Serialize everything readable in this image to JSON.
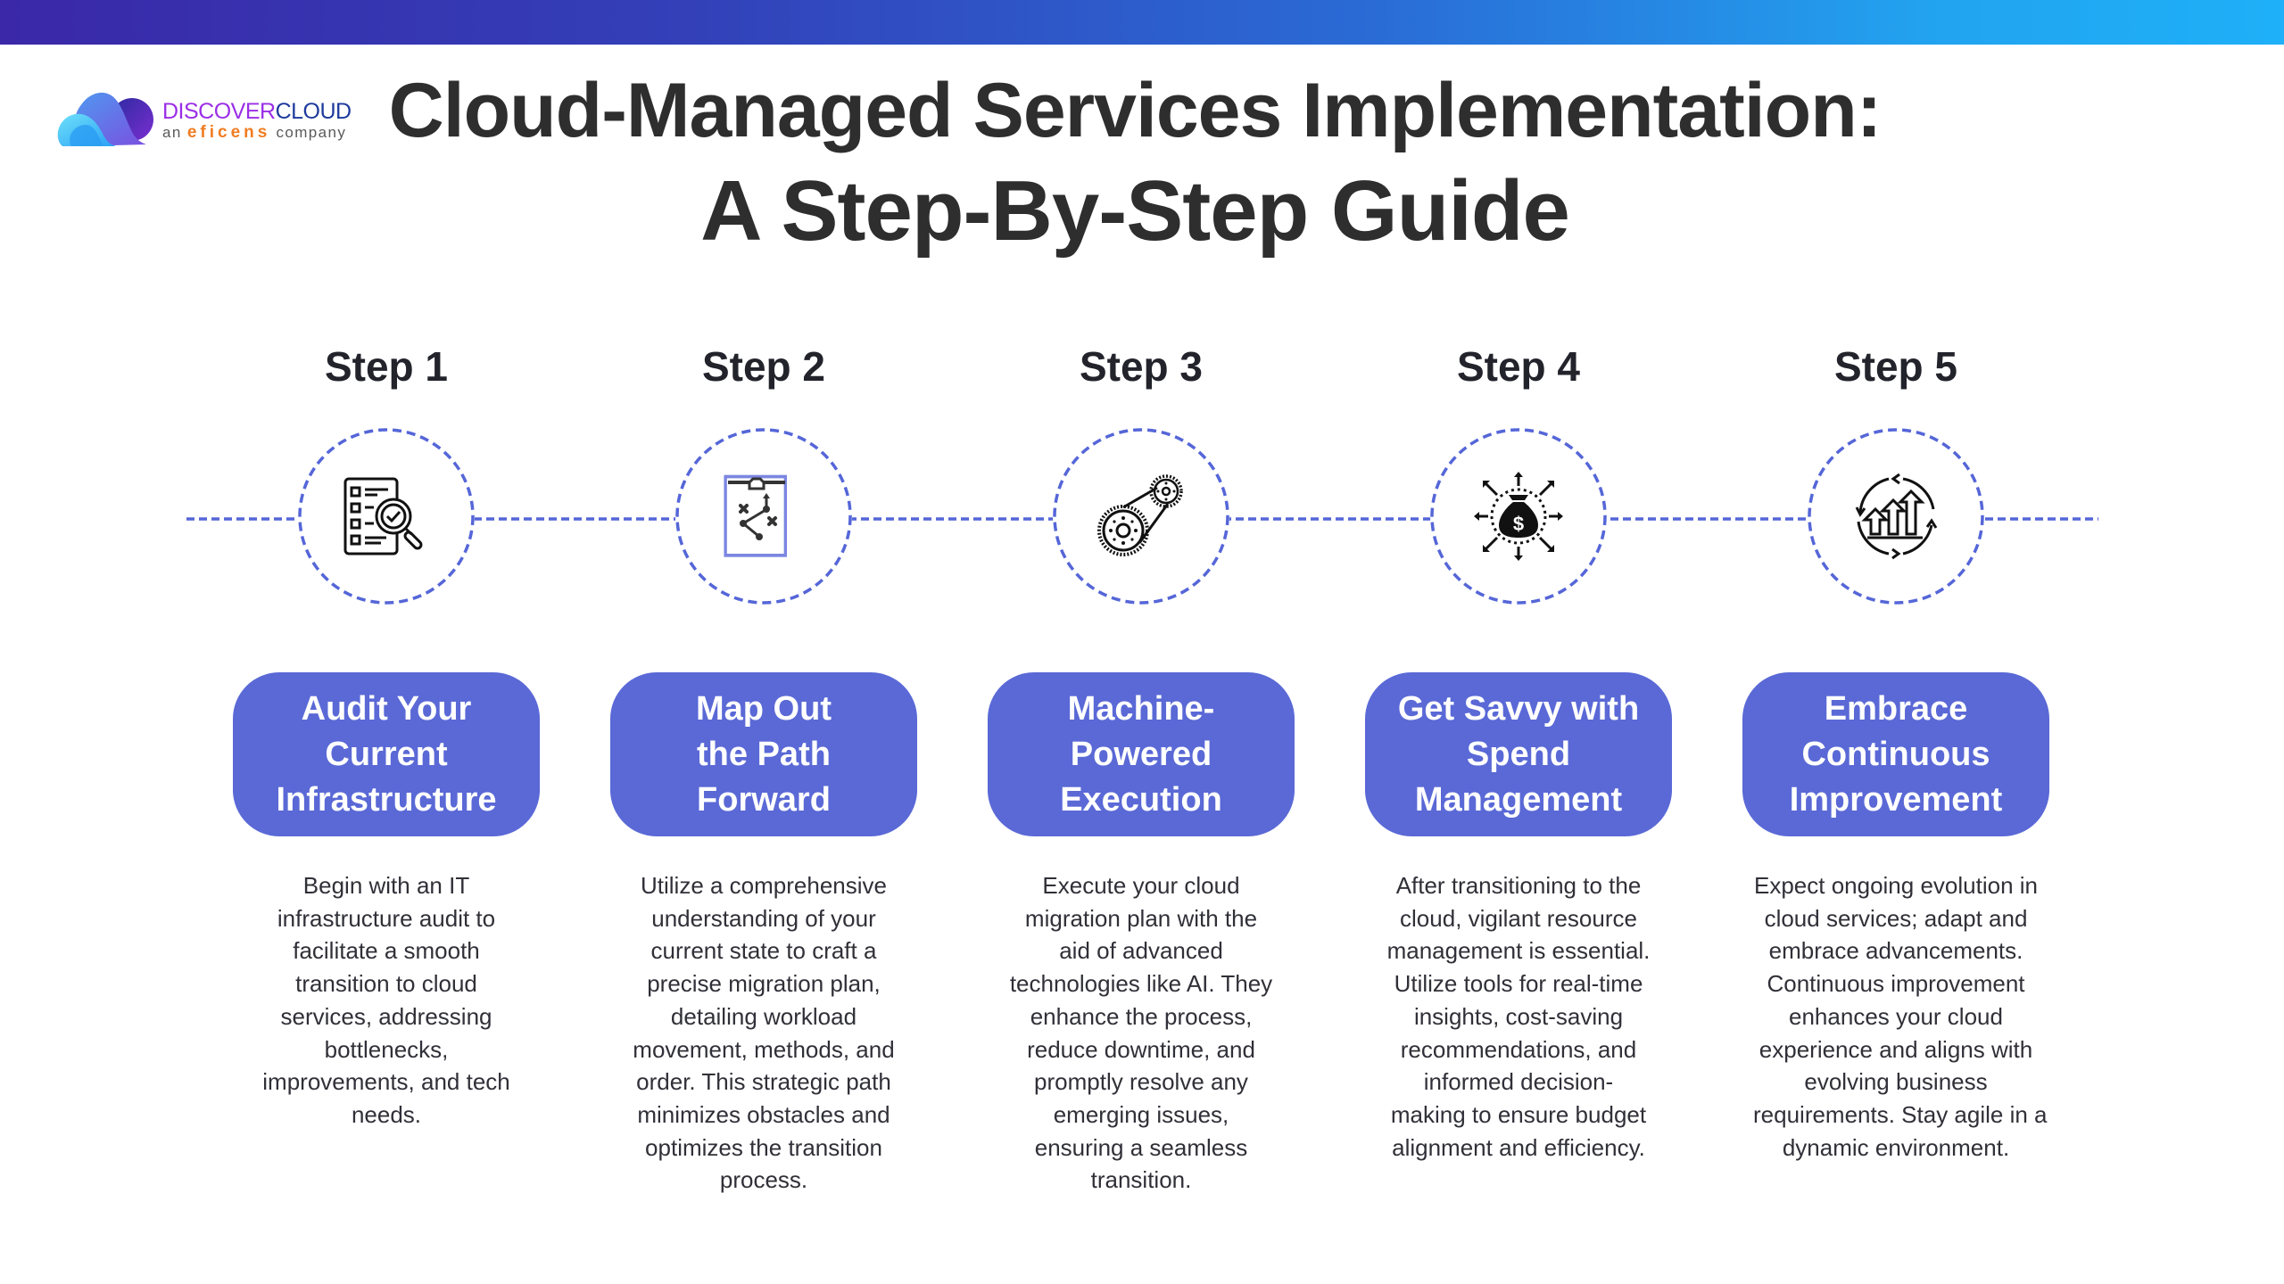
{
  "brand": {
    "name_part1": "DISCOVER",
    "name_part2": "CLOUD",
    "tagline_prefix": "an",
    "tagline_company": "eficens",
    "tagline_suffix": "company",
    "logo_icon": "cloud-logo-icon"
  },
  "header": {
    "title_line1": "Cloud-Managed Services Implementation:",
    "title_line2": "A Step-By-Step Guide"
  },
  "colors": {
    "accent": "#5a69d6",
    "dashed_line": "#5566d8",
    "title_text": "#2e2e2e",
    "body_text": "#303038",
    "topbar_start": "#3a28a8",
    "topbar_end": "#1eb0f8",
    "brand_purple": "#9a2ee6",
    "brand_navy": "#1d3a9c",
    "brand_orange": "#f07d22"
  },
  "steps": [
    {
      "label": "Step 1",
      "icon": "audit-checklist-magnifier-icon",
      "title_lines": [
        "Audit Your",
        "Current",
        "Infrastructure"
      ],
      "description_lines": [
        "Begin with an IT",
        "infrastructure audit to",
        "facilitate a smooth",
        "transition to cloud",
        "services, addressing",
        "bottlenecks,",
        "improvements, and tech",
        "needs."
      ]
    },
    {
      "label": "Step 2",
      "icon": "strategy-clipboard-icon",
      "title_lines": [
        "Map Out",
        "the Path",
        "Forward"
      ],
      "description_lines": [
        "Utilize a comprehensive",
        "understanding of your",
        "current state to craft a",
        "precise migration plan,",
        "detailing workload",
        "movement, methods, and",
        "order. This strategic path",
        "minimizes obstacles and",
        "optimizes the transition",
        "process."
      ]
    },
    {
      "label": "Step 3",
      "icon": "gears-belt-icon",
      "title_lines": [
        "Machine-",
        "Powered",
        "Execution"
      ],
      "description_lines": [
        "Execute your cloud",
        "migration plan with the",
        "aid of advanced",
        "technologies like AI. They",
        "enhance the process,",
        "reduce downtime, and",
        "promptly resolve any",
        "emerging issues,",
        "ensuring a seamless",
        "transition."
      ]
    },
    {
      "label": "Step 4",
      "icon": "money-bag-distribution-icon",
      "title_lines": [
        "Get Savvy with",
        "Spend",
        "Management"
      ],
      "description_lines": [
        "After transitioning to the",
        "cloud, vigilant resource",
        "management is essential.",
        "Utilize tools for real-time",
        "insights, cost-saving",
        "recommendations, and",
        "informed decision-",
        "making to ensure budget",
        "alignment and efficiency."
      ]
    },
    {
      "label": "Step 5",
      "icon": "growth-cycle-arrows-icon",
      "title_lines": [
        "Embrace",
        "Continuous",
        "Improvement"
      ],
      "description_lines": [
        "Expect ongoing evolution in",
        "cloud services; adapt and",
        "embrace advancements.",
        "Continuous improvement",
        "enhances your cloud",
        "experience and aligns with",
        "evolving business",
        "requirements. Stay agile in a",
        "dynamic environment."
      ]
    }
  ]
}
